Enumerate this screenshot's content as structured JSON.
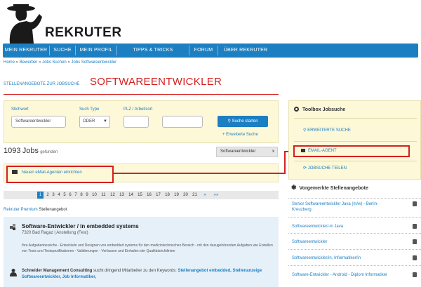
{
  "brand": {
    "name": "REKRUTER"
  },
  "nav": [
    "MEIN REKRUTER",
    "SUCHE",
    "MEIN PROFIL",
    "TIPPS & TRICKS",
    "FORUM",
    "ÜBER REKRUTER"
  ],
  "breadcrumb": [
    "Home",
    "Bewerber",
    "Jobs Suchen",
    "Jobs Softwareentwickler"
  ],
  "section_label": "STELLENANGEBOTE ZUR JOBSUCHE",
  "page_title": "SOFTWAREENTWICKLER",
  "search": {
    "keyword_label": "Stichwort",
    "keyword_value": "Softwareentwickler",
    "type_label": "Such Type",
    "type_value": "ODER",
    "location_label": "PLZ / Arbeitsort",
    "plz_value": "",
    "ort_value": "",
    "submit_label": "Suche starten",
    "advanced_link": "+ Erweiterte Suche"
  },
  "results": {
    "count": "1093",
    "unit": "Jobs",
    "suffix": "gefunden",
    "filter_tag": "Softwareentwickler",
    "filter_remove": "x"
  },
  "alert": {
    "label": "Neuen eMail-Agenten einrichten"
  },
  "pagination": {
    "pages": [
      "1",
      "2",
      "3",
      "4",
      "5",
      "6",
      "7",
      "8",
      "9",
      "10",
      "11",
      "12",
      "13",
      "14",
      "15",
      "16",
      "17",
      "18",
      "19",
      "20",
      "21"
    ],
    "current": "1",
    "next": "»",
    "last": "»»"
  },
  "premium": {
    "prefix": "Rekruter Premium",
    "label": "Stellenangebot"
  },
  "job": {
    "title": "Software-Entwickler / in embedded systems",
    "meta": "7320 Bad Ragaz | Anstellung (Fest)",
    "description": "Ihre Aufgabenbereiche - Entwickeln und Designen von embedded systems für den medizintechnischen Bereich - mit den dazugehörenden Aufgaben wie Erstellen von Tests und Testspezifikationen - Validierungen - Verfassen und Einhalten der Qualitätsrichtlinien",
    "company": "Schneider Management Consulting",
    "company_text": "sucht dringend Mitarbeiter zu den Keywords:",
    "keywords": [
      "Stellenangebot embedded,",
      "Stellenanzeige Softwareentwickler,",
      "Job Informatiker,"
    ]
  },
  "toolbox": {
    "title": "Toolbox Jobsuche",
    "links": [
      "ERWEITERTE SUCHE",
      "EMAIL-AGENT",
      "JOBSUCHE TEILEN"
    ]
  },
  "favorites": {
    "title": "Vorgemerkte Stellenangebote",
    "items": [
      "Senior Softwareentwickler Java (m/w) - Berlin-Kreuzberg",
      "Softwareentwickler/-in Java",
      "Softwareentwickler",
      "Softwareentwickler/in, Informatiker/in",
      "Software-Entwickler - Android - Diplom Informatiker"
    ]
  },
  "colors": {
    "nav_blue": "#1c7fc2",
    "highlight_red": "#d61f1f",
    "panel_yellow": "#fdf8d8"
  }
}
